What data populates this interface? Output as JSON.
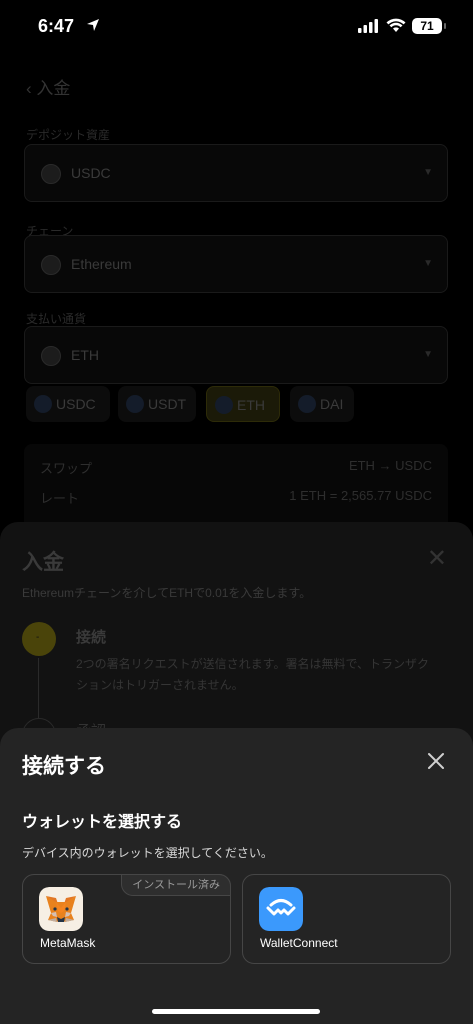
{
  "status": {
    "time": "6:47",
    "battery": "71"
  },
  "background": {
    "header": "入金",
    "label1": "デポジット資産",
    "asset": "USDC",
    "label2": "チェーン",
    "chain": "Ethereum",
    "label3": "支払い通貨",
    "pay": "ETH",
    "chips": [
      "USDC",
      "USDT",
      "ETH",
      "DAI"
    ],
    "summary": {
      "swap_label": "スワップ",
      "swap_value": "ETH → USDC",
      "rate_label": "レート",
      "rate_value": "1 ETH = 2,565.77 USDC"
    }
  },
  "deposit_sheet": {
    "title": "入金",
    "description": "Ethereumチェーンを介してETHで0.01を入金します。",
    "step1_title": "接続",
    "step1_desc": "2つの署名リクエストが送信されます。署名は無料で、トランザクションはトリガーされません。",
    "step2_title": "承認"
  },
  "connect_sheet": {
    "title": "接続する",
    "subtitle": "ウォレットを選択する",
    "description": "デバイス内のウォレットを選択してください。",
    "wallets": [
      {
        "name": "MetaMask",
        "badge": "インストール済み",
        "icon": "metamask-fox-icon"
      },
      {
        "name": "WalletConnect",
        "icon": "walletconnect-icon"
      }
    ]
  },
  "colors": {
    "sheet": "#242424",
    "accent": "#f0d20a",
    "walletconnect": "#3b99fc"
  }
}
